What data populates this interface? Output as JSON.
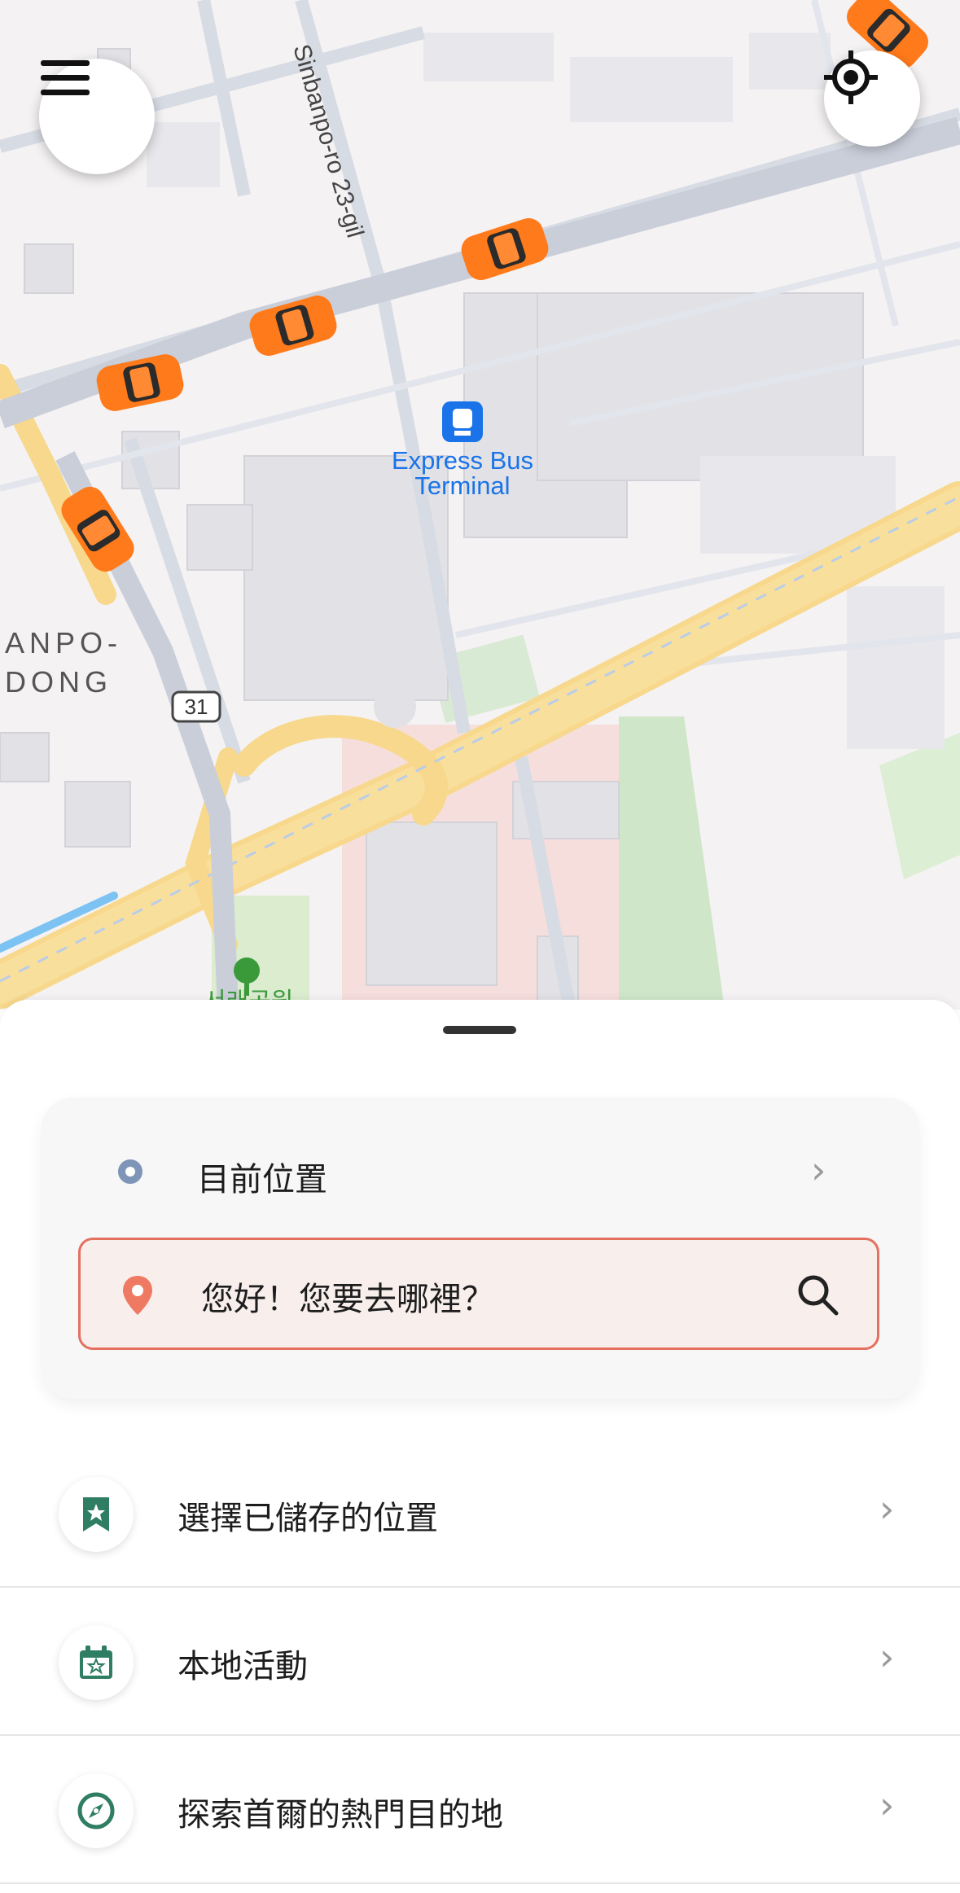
{
  "map": {
    "street_label": "Sinbanpo-ro 23-gil",
    "poi_label_line1": "Express Bus",
    "poi_label_line2": "Terminal",
    "district_line1": "ANPO-",
    "district_line2": "DONG",
    "route_shield": "31",
    "park_label": "서래공원"
  },
  "controls": {
    "menu_icon": "hamburger-menu-icon",
    "locate_icon": "crosshair-locate-icon"
  },
  "sheet": {
    "current_location_label": "目前位置",
    "destination_placeholder": "您好！您要去哪裡？",
    "items": [
      {
        "label": "選擇已儲存的位置",
        "icon": "bookmark-star-icon"
      },
      {
        "label": "本地活動",
        "icon": "calendar-star-icon"
      },
      {
        "label": "探索首爾的熱門目的地",
        "icon": "compass-icon"
      }
    ]
  },
  "colors": {
    "accent": "#e4705f",
    "icon_green": "#2f7d63",
    "taxi_orange": "#ff7a1a",
    "poi_blue": "#1a73e8"
  }
}
